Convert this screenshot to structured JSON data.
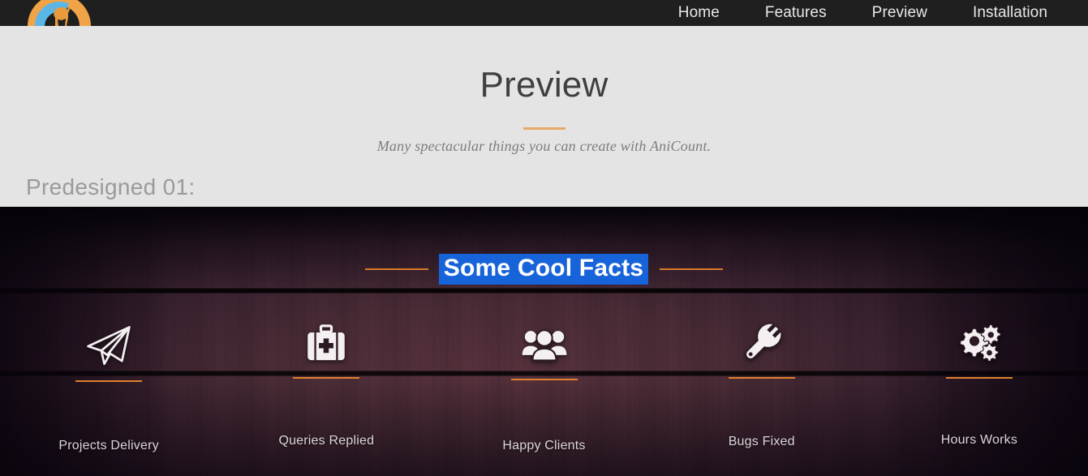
{
  "navbar": {
    "logo_name": "anicount-logo",
    "links": [
      {
        "label": "Home"
      },
      {
        "label": "Features"
      },
      {
        "label": "Preview"
      },
      {
        "label": "Installation"
      }
    ]
  },
  "light_section": {
    "title": "Preview",
    "subtitle": "Many spectacular things you can create with AniCount.",
    "predesigned_label": "Predesigned 01:"
  },
  "wood_section": {
    "facts_title": "Some Cool Facts",
    "facts_title_selected": true,
    "counters": [
      {
        "icon": "paper-plane-icon",
        "label": "Projects Delivery",
        "value": ""
      },
      {
        "icon": "first-aid-kit-icon",
        "label": "Queries Replied",
        "value": ""
      },
      {
        "icon": "users-group-icon",
        "label": "Happy Clients",
        "value": ""
      },
      {
        "icon": "wrench-icon",
        "label": "Bugs Fixed",
        "value": ""
      },
      {
        "icon": "cogs-icon",
        "label": "Hours Works",
        "value": ""
      }
    ]
  },
  "colors": {
    "navbar_bg": "#1f1f1f",
    "light_bg": "#e4e4e4",
    "accent_orange": "#e0802c",
    "title_underline": "#e8a96a",
    "selection_blue": "#1763d9",
    "logo_orange": "#f0a447",
    "logo_blue": "#5bb6e8",
    "heading_text": "#3f3f3f",
    "subtitle_text": "#7d7d80",
    "predesigned_text": "#9a9a9a"
  }
}
